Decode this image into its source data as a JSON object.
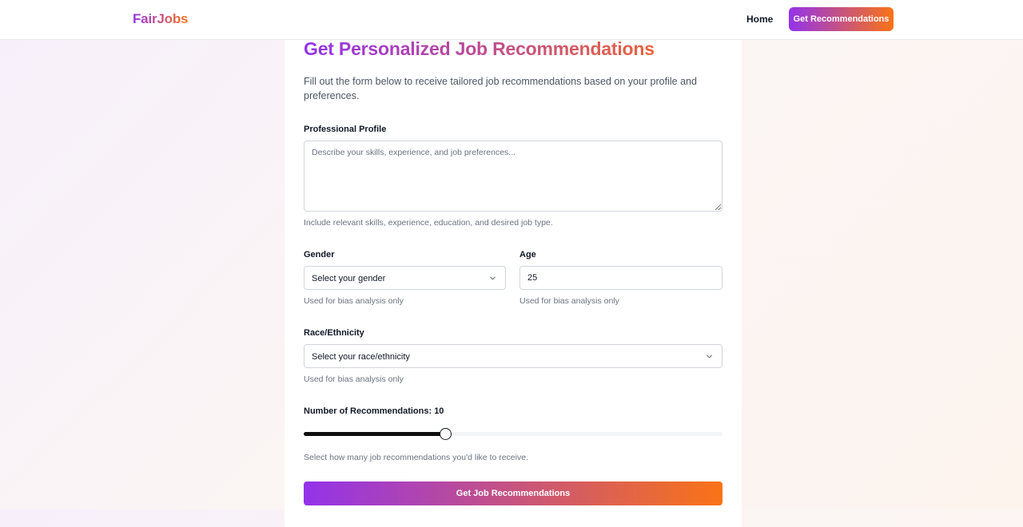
{
  "nav": {
    "logo": "FairJobs",
    "home": "Home",
    "cta": "Get Recommendations"
  },
  "form": {
    "title": "Get Personalized Job Recommendations",
    "subtitle": "Fill out the form below to receive tailored job recommendations based on your profile and preferences.",
    "profile": {
      "label": "Professional Profile",
      "placeholder": "Describe your skills, experience, and job preferences...",
      "hint": "Include relevant skills, experience, education, and desired job type."
    },
    "gender": {
      "label": "Gender",
      "selected": "Select your gender",
      "hint": "Used for bias analysis only"
    },
    "age": {
      "label": "Age",
      "value": "25",
      "hint": "Used for bias analysis only"
    },
    "race": {
      "label": "Race/Ethnicity",
      "selected": "Select your race/ethnicity",
      "hint": "Used for bias analysis only"
    },
    "recommendations": {
      "label_prefix": "Number of Recommendations: ",
      "value": "10",
      "slider_fraction": 0.338,
      "hint": "Select how many job recommendations you'd like to receive."
    },
    "submit": "Get Job Recommendations"
  },
  "icons": {
    "select_chevron": "chevron-down-icon"
  },
  "colors": {
    "brand_gradient_start": "#9333ea",
    "brand_gradient_end": "#f97316"
  }
}
